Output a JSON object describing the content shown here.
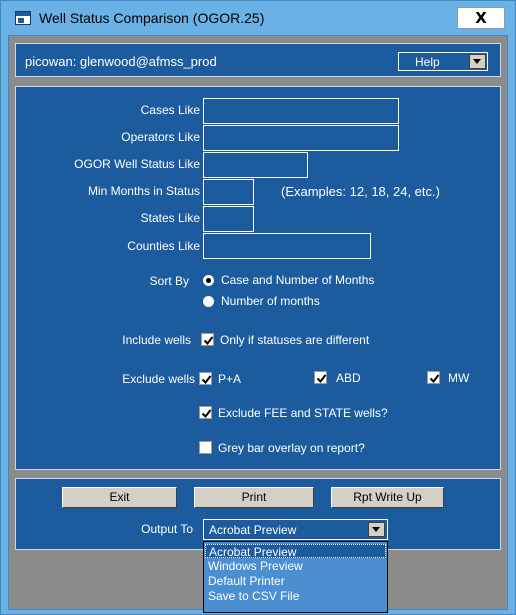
{
  "window": {
    "title": "Well Status Comparison (OGOR.25)",
    "close_label": "X",
    "icon": "app-window-icon"
  },
  "header": {
    "user": "picowan: glenwood@afmss_prod",
    "help_value": "Help"
  },
  "form": {
    "cases_label": "Cases Like",
    "operators_label": "Operators Like",
    "ogor_status_label": "OGOR Well Status Like",
    "min_months_label": "Min Months in Status",
    "min_months_example": "(Examples: 12, 18, 24, etc.)",
    "states_label": "States Like",
    "counties_label": "Counties Like",
    "sort_by_label": "Sort By",
    "sort_options": [
      {
        "label": "Case and Number of Months",
        "selected": true
      },
      {
        "label": "Number of months",
        "selected": false
      }
    ],
    "include_wells_label": "Include wells",
    "include_option": {
      "label": "Only if statuses are different",
      "checked": true
    },
    "exclude_wells_label": "Exclude wells",
    "exclude_options": [
      {
        "label": "P+A",
        "checked": true
      },
      {
        "label": "ABD",
        "checked": true
      },
      {
        "label": "MW",
        "checked": true
      }
    ],
    "exclude_fee_state": {
      "label": "Exclude FEE and STATE wells?",
      "checked": true
    },
    "grey_bar": {
      "label": "Grey bar overlay on report?",
      "checked": false
    }
  },
  "buttons": {
    "exit": "Exit",
    "print": "Print",
    "rpt_write_up": "Rpt Write Up"
  },
  "output": {
    "label": "Output To",
    "selected": "Acrobat Preview",
    "options": [
      "Acrobat Preview",
      "Windows Preview",
      "Default Printer",
      "Save to CSV File"
    ]
  },
  "colors": {
    "panel": "#1c5c9e",
    "frame": "#6ab1e6",
    "dropdown_list": "#4b8fd0"
  }
}
